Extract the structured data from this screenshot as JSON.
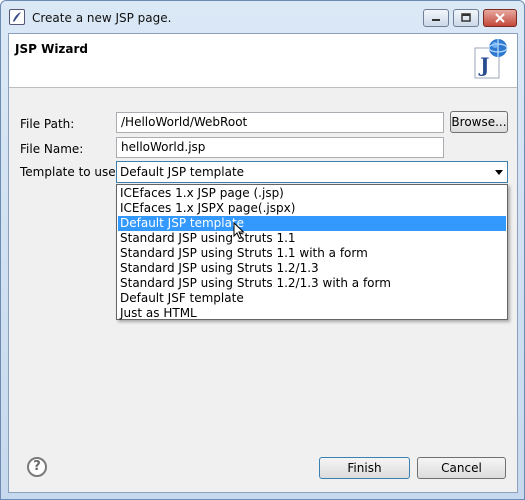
{
  "window": {
    "title": "Create a new JSP page."
  },
  "banner": {
    "title": "JSP Wizard",
    "logo_letter": "J"
  },
  "form": {
    "file_path_label": "File Path:",
    "file_path_value": "/HelloWorld/WebRoot",
    "browse_label": "Browse...",
    "file_name_label": "File Name:",
    "file_name_value": "helloWorld.jsp",
    "template_label": "Template to use:",
    "template_selected": "Default JSP template",
    "template_options": [
      "ICEfaces 1.x JSP page (.jsp)",
      "ICEfaces 1.x JSPX page(.jspx)",
      "Default JSP template",
      "Standard JSP using Struts 1.1",
      "Standard JSP using Struts 1.1 with a form",
      "Standard JSP using Struts 1.2/1.3",
      "Standard JSP using Struts 1.2/1.3 with a form",
      "Default JSF template",
      "Just as HTML"
    ],
    "highlighted_option_index": 2
  },
  "footer": {
    "help_symbol": "?",
    "finish_label": "Finish",
    "cancel_label": "Cancel"
  },
  "icons": {
    "app": "eclipse-icon",
    "minimize": "minimize-icon",
    "maximize": "maximize-icon",
    "close": "close-icon",
    "help": "help-icon",
    "dropdown_arrow": "chevron-down-icon",
    "pointer": "mouse-pointer-icon"
  },
  "colors": {
    "selection": "#3399ff",
    "title_gradient_top": "#dbe8f6",
    "close_button": "#c2473a"
  }
}
